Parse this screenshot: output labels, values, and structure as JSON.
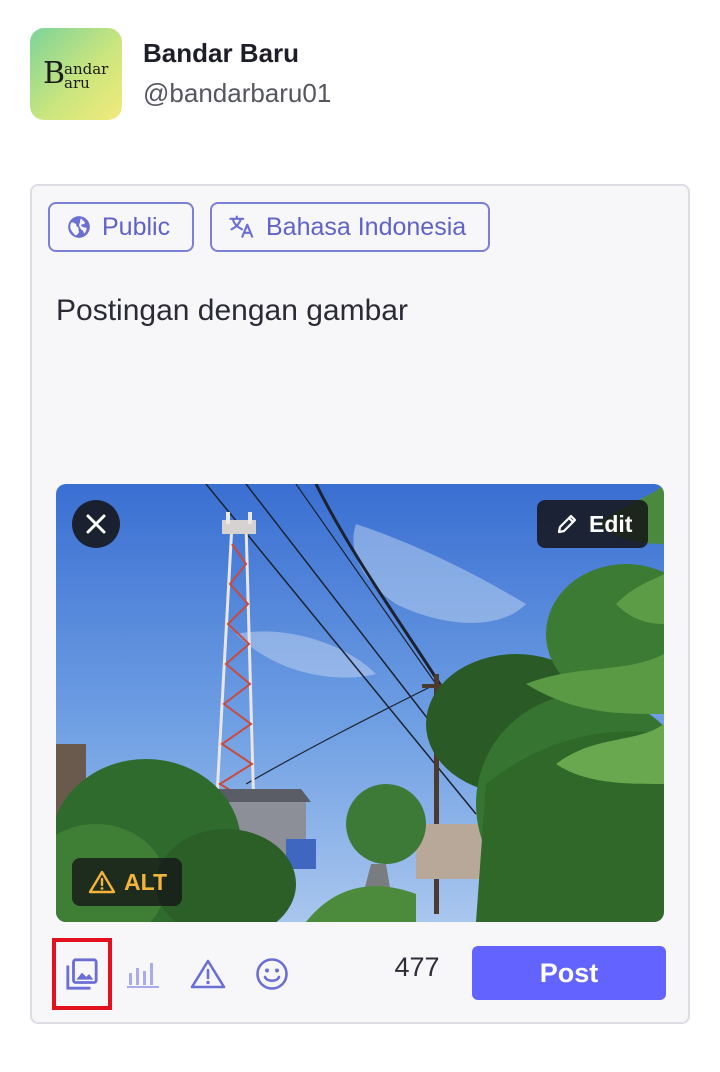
{
  "account": {
    "display_name": "Bandar Baru",
    "handle": "@bandarbaru01",
    "avatar_letter": "B",
    "avatar_line1": "andar",
    "avatar_line2": "aru"
  },
  "composer": {
    "visibility_label": "Public",
    "language_label": "Bahasa Indonesia",
    "text": "Postingan dengan gambar",
    "media": {
      "edit_label": "Edit",
      "alt_label": "ALT",
      "alt_warning_color": "#f2b43a"
    },
    "char_counter": "477",
    "post_label": "Post",
    "highlighted_tool": "media-button"
  },
  "colors": {
    "accent": "#6364ff",
    "chip": "#5f63c9",
    "highlight": "#e3101d"
  }
}
